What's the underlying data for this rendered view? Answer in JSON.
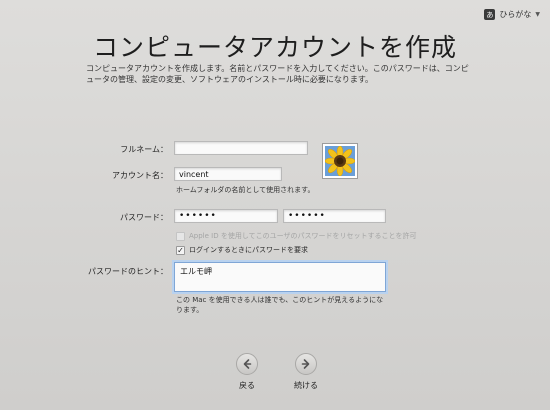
{
  "ime": {
    "badge": "あ",
    "label": "ひらがな"
  },
  "title": "コンピュータアカウントを作成",
  "intro": "コンピュータアカウントを作成します。名前とパスワードを入力してください。このパスワードは、コンピュータの管理、設定の変更、ソフトウェアのインストール時に必要になります。",
  "form": {
    "full_name_label": "フルネーム：",
    "full_name_value": "",
    "account_label": "アカウント名：",
    "account_value": "vincent",
    "account_help": "ホームフォルダの名前として使用されます。",
    "password_label": "パスワード：",
    "password_value": "••••••",
    "password_confirm_value": "••••••",
    "appleid_check_label": "Apple ID を使用してこのユーザのパスワードをリセットすることを許可",
    "require_password_check_label": "ログインするときにパスワードを要求",
    "require_password_checked": "✓",
    "hint_label": "パスワードのヒント：",
    "hint_value": "エルモ岬",
    "hint_help": "この Mac を使用できる人は誰でも、このヒントが見えるようになります。"
  },
  "nav": {
    "back_label": "戻る",
    "continue_label": "続ける"
  },
  "colors": {
    "background": "#d7d6d4",
    "focus_ring": "#7fa6d6"
  }
}
